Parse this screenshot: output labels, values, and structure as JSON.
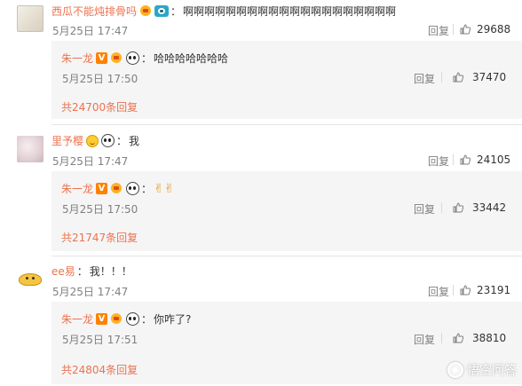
{
  "comments": [
    {
      "username": "西瓜不能炖排骨吗",
      "text": "啊啊啊啊啊啊啊啊啊啊啊啊啊啊啊啊啊啊啊啊",
      "time": "5月25日 17:47",
      "reply_label": "回复",
      "likes": "29688",
      "reply": {
        "username": "朱一龙",
        "text": "哈哈哈哈哈哈哈",
        "time": "5月25日 17:50",
        "reply_label": "回复",
        "likes": "37470",
        "total": "共24700条回复"
      }
    },
    {
      "username": "里予樱",
      "text": "我",
      "time": "5月25日 17:47",
      "reply_label": "回复",
      "likes": "24105",
      "reply": {
        "username": "朱一龙",
        "text": "✌✌",
        "time": "5月25日 17:50",
        "reply_label": "回复",
        "likes": "33442",
        "total": "共21747条回复"
      }
    },
    {
      "username": "ee易",
      "text": "我！！！",
      "time": "5月25日 17:47",
      "reply_label": "回复",
      "likes": "23191",
      "reply": {
        "username": "朱一龙",
        "text": "你咋了?",
        "time": "5月25日 17:51",
        "reply_label": "回复",
        "likes": "38810",
        "total": "共24804条回复"
      }
    }
  ],
  "watermark": "悟空问答",
  "icons": {
    "like": "thumbs-up-icon",
    "verified": "v-badge-icon",
    "vip": "crown-badge-icon",
    "panda": "panda-badge-icon"
  },
  "colors": {
    "username": "#eb7350",
    "muted": "#808080",
    "reply_bg": "#f5f5f5"
  }
}
